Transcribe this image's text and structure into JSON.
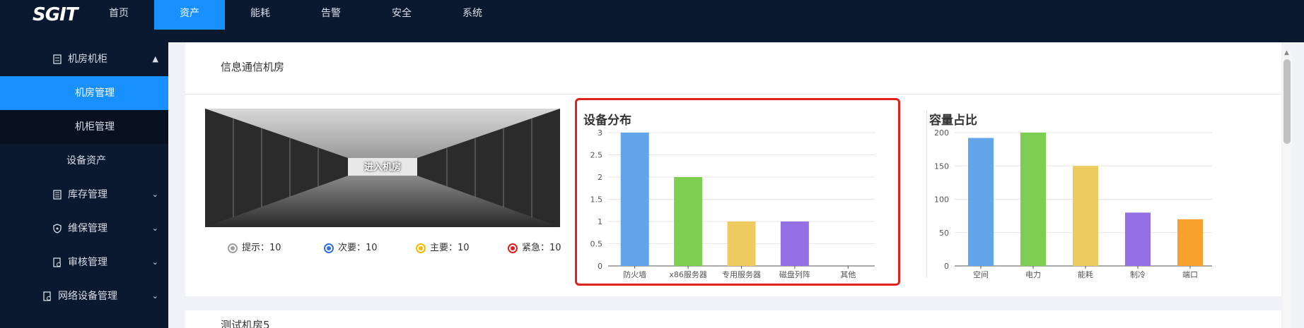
{
  "logo": "SGIT",
  "nav": [
    {
      "label": "首页",
      "active": false
    },
    {
      "label": "资产",
      "active": true
    },
    {
      "label": "能耗",
      "active": false
    },
    {
      "label": "告警",
      "active": false
    },
    {
      "label": "安全",
      "active": false
    },
    {
      "label": "系统",
      "active": false
    }
  ],
  "sidebar": {
    "items": [
      {
        "label": "机房机柜",
        "icon": "cabinet-icon",
        "chevron": "up"
      },
      {
        "label": "机房管理",
        "selected": true
      },
      {
        "label": "机柜管理"
      },
      {
        "label": "设备资产"
      },
      {
        "label": "库存管理",
        "icon": "inventory-icon",
        "chevron": "down"
      },
      {
        "label": "维保管理",
        "icon": "shield-icon",
        "chevron": "down"
      },
      {
        "label": "审核管理",
        "icon": "audit-icon",
        "chevron": "down"
      },
      {
        "label": "网络设备管理",
        "icon": "network-icon",
        "chevron": "down"
      }
    ]
  },
  "room": {
    "title": "信息通信机房",
    "enter_label": "进入机房",
    "alarms": [
      {
        "label": "提示：10",
        "color": "#9e9e9e"
      },
      {
        "label": "次要：10",
        "color": "#2f6fe0"
      },
      {
        "label": "主要：10",
        "color": "#f5b800"
      },
      {
        "label": "紧急：10",
        "color": "#e02020"
      }
    ]
  },
  "room2": {
    "title": "测试机房5"
  },
  "chart_data": [
    {
      "type": "bar",
      "title": "设备分布",
      "categories": [
        "防火墙",
        "x86服务器",
        "专用服务器",
        "磁盘列阵",
        "其他"
      ],
      "values": [
        3,
        2,
        1,
        1,
        0
      ],
      "colors": [
        "#62a5e8",
        "#7ecf51",
        "#eecb5f",
        "#9570e5",
        "#f7a12b"
      ],
      "ylim": [
        0,
        3
      ],
      "yticks": [
        0,
        0.5,
        1,
        1.5,
        2,
        2.5,
        3
      ],
      "grid": true
    },
    {
      "type": "bar",
      "title": "容量占比",
      "categories": [
        "空间",
        "电力",
        "能耗",
        "制冷",
        "端口"
      ],
      "values": [
        192,
        200,
        150,
        80,
        70
      ],
      "colors": [
        "#62a5e8",
        "#7ecf51",
        "#eecb5f",
        "#9570e5",
        "#f7a12b"
      ],
      "ylim": [
        0,
        200
      ],
      "yticks": [
        0,
        50,
        100,
        150,
        200
      ],
      "grid": true
    }
  ]
}
